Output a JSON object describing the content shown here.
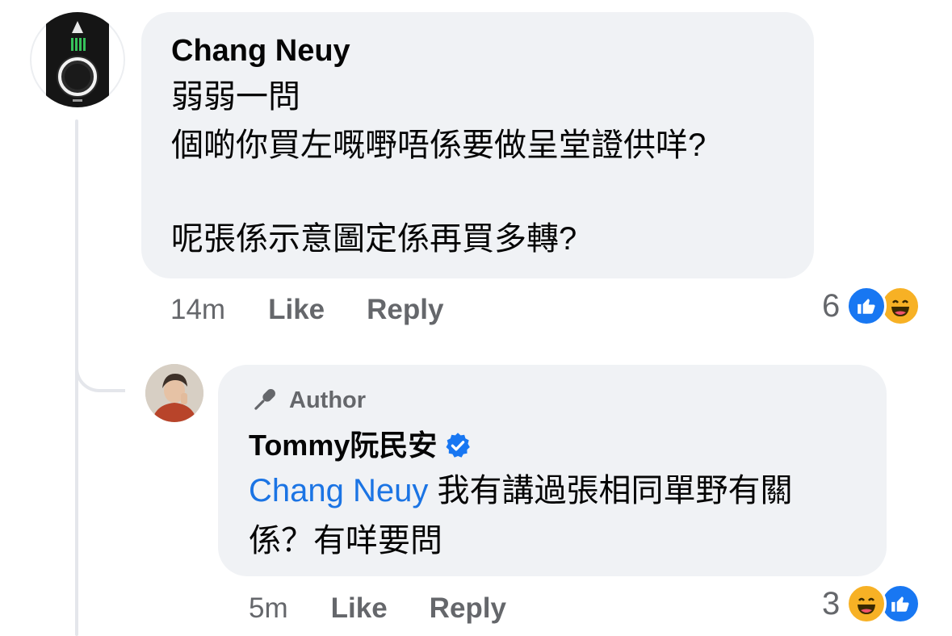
{
  "comments": [
    {
      "author": "Chang Neuy",
      "lines": [
        "弱弱一問",
        "個啲你買左嘅嘢唔係要做呈堂證供咩?",
        "",
        "呢張係示意圖定係再買多轉?"
      ],
      "time": "14m",
      "like_label": "Like",
      "reply_label": "Reply",
      "reaction_count": "6",
      "reactions": [
        "like-icon",
        "haha-icon"
      ]
    },
    {
      "badge": "Author",
      "author": "Tommy阮民安",
      "verified": true,
      "mention": "Chang Neuy",
      "line1_rest": " 我有講過張相同單野有關",
      "line2": "係？有咩要問",
      "time": "5m",
      "like_label": "Like",
      "reply_label": "Reply",
      "reaction_count": "3",
      "reactions": [
        "haha-icon",
        "like-icon"
      ]
    }
  ],
  "colors": {
    "bubble": "#f0f2f5",
    "mention": "#1b74e4",
    "meta": "#65676b",
    "like": "#1877f2",
    "haha": "#f7b125",
    "verified": "#1877f2"
  }
}
